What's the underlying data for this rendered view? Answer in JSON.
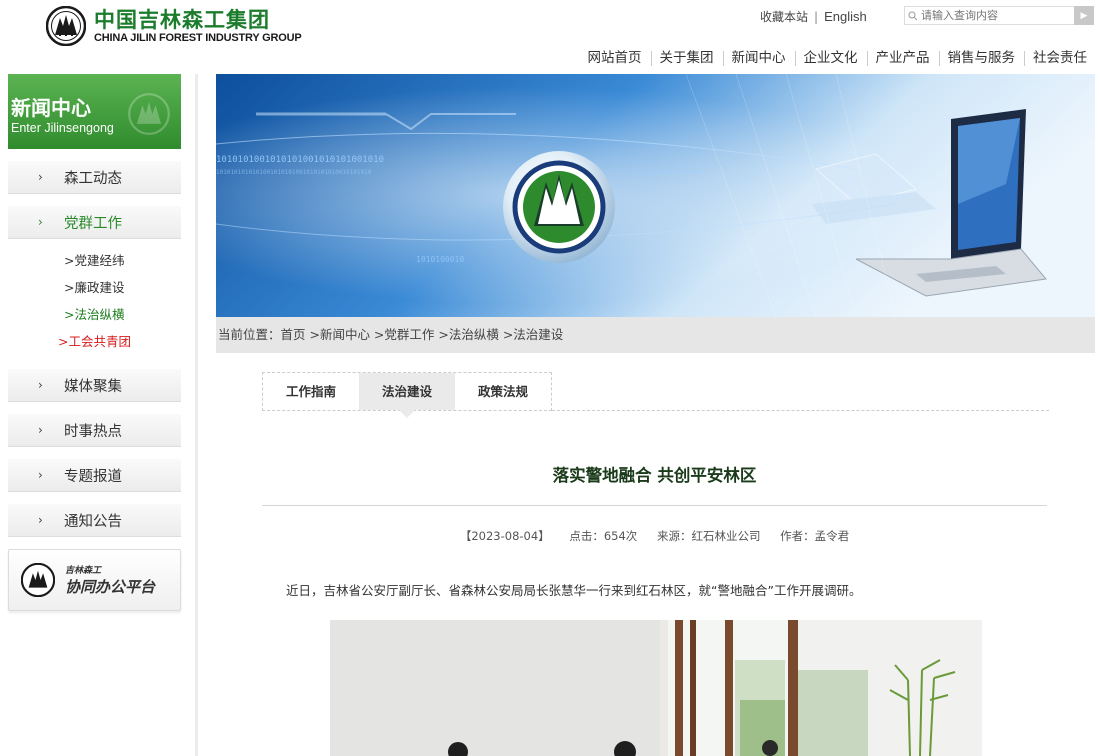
{
  "header": {
    "logo_cn": "中国吉林森工集团",
    "logo_en": "CHINA JILIN FOREST INDUSTRY GROUP",
    "favorite": "收藏本站",
    "separator": "|",
    "english": "English",
    "search_placeholder": "请输入查询内容",
    "nav": [
      "网站首页",
      "关于集团",
      "新闻中心",
      "企业文化",
      "产业产品",
      "销售与服务",
      "社会责任"
    ]
  },
  "sidebar": {
    "title": "新闻中心",
    "subtitle": "Enter Jilinsengong",
    "items": [
      {
        "label": "森工动态"
      },
      {
        "label": "党群工作"
      },
      {
        "label": "媒体聚集"
      },
      {
        "label": "时事热点"
      },
      {
        "label": "专题报道"
      },
      {
        "label": "通知公告"
      }
    ],
    "subitems": [
      "党建经纬",
      "廉政建设",
      "法治纵横",
      "工会共青团"
    ],
    "oa_small": "吉林森工",
    "oa_big": "协同办公平台"
  },
  "breadcrumb": "当前位置：首页 >新闻中心 >党群工作 >法治纵横 >法治建设",
  "tabs": [
    "工作指南",
    "法治建设",
    "政策法规"
  ],
  "article": {
    "title": "落实警地融合 共创平安林区",
    "date": "【2023-08-04】",
    "clicks": "点击：654次",
    "source": "来源：红石林业公司",
    "author": "作者：孟令君",
    "body": "近日，吉林省公安厅副厅长、省森林公安局局长张慧华一行来到红石林区，就“警地融合”工作开展调研。"
  },
  "colors": {
    "brand_green": "#1b7c2c",
    "accent_red": "#d71c1c",
    "banner_blue": "#1f6fb8"
  }
}
